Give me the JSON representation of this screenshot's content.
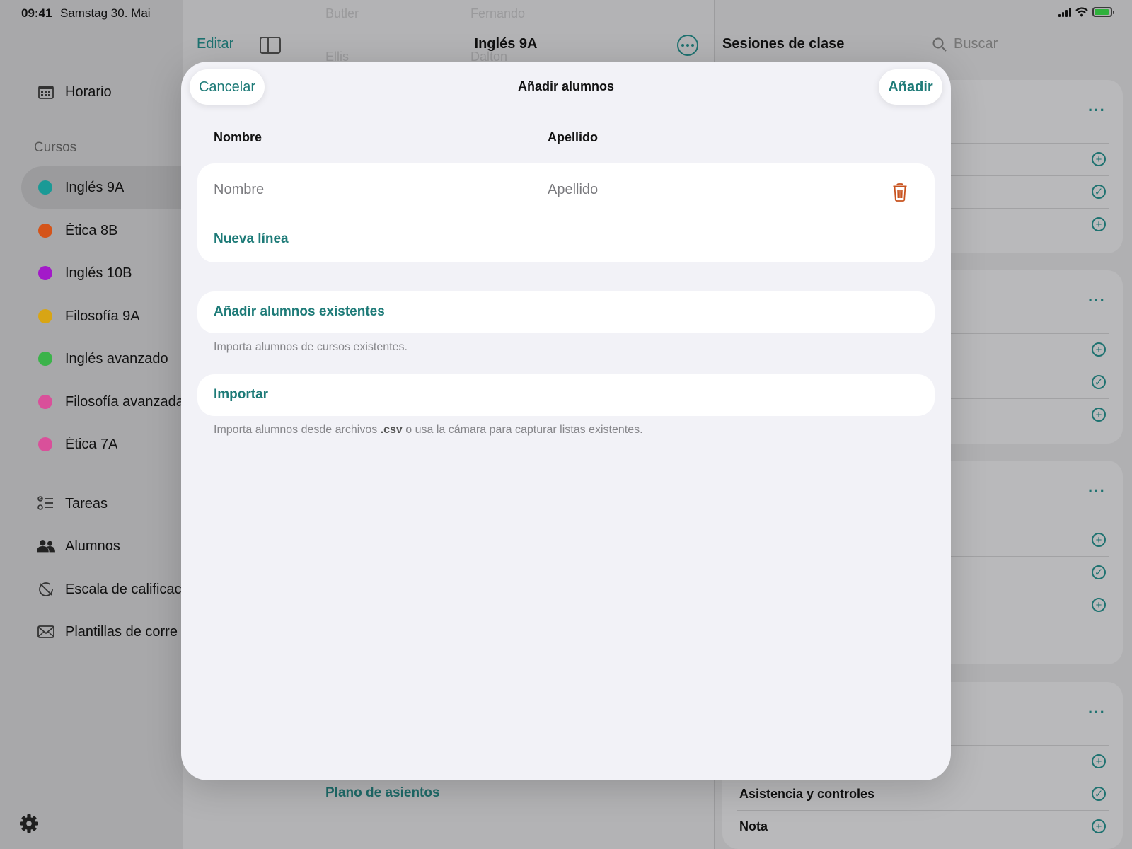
{
  "status_bar": {
    "time": "09:41",
    "date": "Samstag 30. Mai"
  },
  "sidebar": {
    "schedule_label": "Horario",
    "courses_heading": "Cursos",
    "courses": [
      {
        "label": "Inglés 9A",
        "color": "#1a9a96",
        "selected": true
      },
      {
        "label": "Ética 8B",
        "color": "#d4541a",
        "selected": false
      },
      {
        "label": "Inglés 10B",
        "color": "#a31ac9",
        "selected": false
      },
      {
        "label": "Filosofía 9A",
        "color": "#d8a514",
        "selected": false
      },
      {
        "label": "Inglés avanzado",
        "color": "#3bb34a",
        "selected": false
      },
      {
        "label": "Filosofía avanzada",
        "color": "#d9509a",
        "selected": false
      },
      {
        "label": "Ética 7A",
        "color": "#d9509a",
        "selected": false
      }
    ],
    "tools": [
      {
        "label": "Tareas",
        "icon": "checklist-icon"
      },
      {
        "label": "Alumnos",
        "icon": "people-icon"
      },
      {
        "label": "Escala de calificac",
        "icon": "no-grade-icon"
      },
      {
        "label": "Plantillas de corre",
        "icon": "envelope-icon"
      }
    ],
    "settings_icon": "gear-icon"
  },
  "middle": {
    "edit_label": "Editar",
    "title": "Inglés 9A",
    "ghost_names": [
      "Butler",
      "Fernando",
      "Ellis",
      "Dalton"
    ],
    "seat_plan_label": "Plano de asientos"
  },
  "right": {
    "title": "Sesiones de clase",
    "search_placeholder": "Buscar",
    "bottom_rows": [
      "Asistencia y controles",
      "Nota"
    ]
  },
  "modal": {
    "title": "Añadir alumnos",
    "cancel_label": "Cancelar",
    "add_label": "Añadir",
    "column_first": "Nombre",
    "column_last": "Apellido",
    "first_placeholder": "Nombre",
    "last_placeholder": "Apellido",
    "new_line_label": "Nueva línea",
    "add_existing_label": "Añadir alumnos existentes",
    "add_existing_hint": "Importa alumnos de cursos existentes.",
    "import_label": "Importar",
    "import_hint_before": "Importa alumnos desde archivos ",
    "import_hint_ext": ".csv",
    "import_hint_after": " o usa la cámara para capturar listas existentes."
  },
  "colors": {
    "accent": "#1e7b78",
    "destructive": "#c8531f"
  }
}
